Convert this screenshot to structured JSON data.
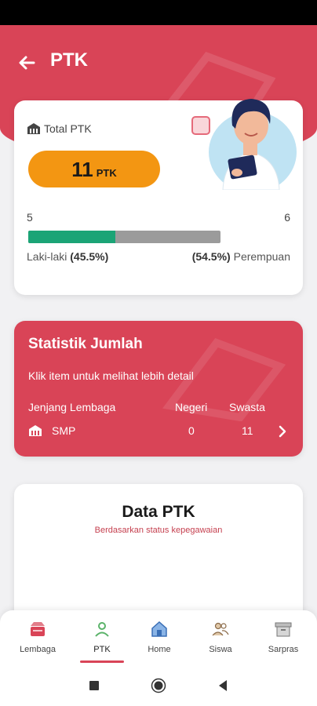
{
  "header": {
    "title": "PTK"
  },
  "total_card": {
    "label": "Total PTK",
    "count": "11",
    "unit": "PTK",
    "male_count": "5",
    "female_count": "6",
    "male_label": "Laki-laki",
    "male_pct": "(45.5%)",
    "female_pct": "(54.5%)",
    "female_label": "Perempuan",
    "male_fraction": 0.455
  },
  "stat_card": {
    "title": "Statistik Jumlah",
    "subtitle": "Klik item untuk melihat lebih detail",
    "headers": {
      "level": "Jenjang Lembaga",
      "public": "Negeri",
      "private": "Swasta"
    },
    "rows": [
      {
        "level": "SMP",
        "public": "0",
        "private": "11"
      }
    ]
  },
  "data_card": {
    "title": "Data PTK",
    "subtitle": "Berdasarkan status kepegawaian"
  },
  "nav": {
    "items": [
      {
        "label": "Lembaga",
        "icon": "institution-icon"
      },
      {
        "label": "PTK",
        "icon": "person-icon"
      },
      {
        "label": "Home",
        "icon": "home-icon"
      },
      {
        "label": "Siswa",
        "icon": "students-icon"
      },
      {
        "label": "Sarpras",
        "icon": "archive-icon"
      }
    ],
    "active": "PTK"
  },
  "colors": {
    "primary": "#d94457",
    "accent": "#f39612",
    "male": "#1ba476",
    "female": "#9b9b9b"
  }
}
